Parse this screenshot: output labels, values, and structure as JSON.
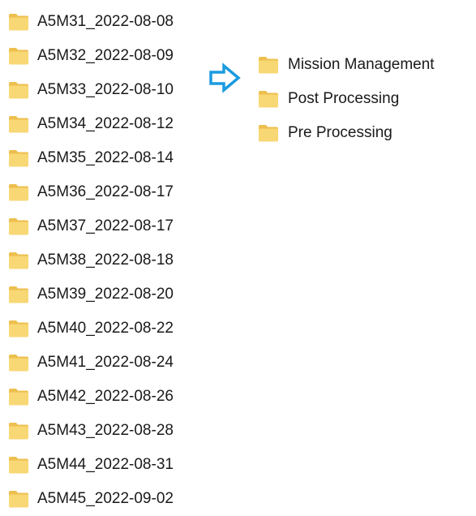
{
  "left_folders": [
    {
      "name": "A5M31_2022-08-08",
      "icon": "folder-icon"
    },
    {
      "name": "A5M32_2022-08-09",
      "icon": "folder-icon"
    },
    {
      "name": "A5M33_2022-08-10",
      "icon": "folder-icon"
    },
    {
      "name": "A5M34_2022-08-12",
      "icon": "folder-icon"
    },
    {
      "name": "A5M35_2022-08-14",
      "icon": "folder-icon"
    },
    {
      "name": "A5M36_2022-08-17",
      "icon": "folder-icon"
    },
    {
      "name": "A5M37_2022-08-17",
      "icon": "folder-icon"
    },
    {
      "name": "A5M38_2022-08-18",
      "icon": "folder-icon"
    },
    {
      "name": "A5M39_2022-08-20",
      "icon": "folder-icon"
    },
    {
      "name": "A5M40_2022-08-22",
      "icon": "folder-icon"
    },
    {
      "name": "A5M41_2022-08-24",
      "icon": "folder-icon"
    },
    {
      "name": "A5M42_2022-08-26",
      "icon": "folder-icon"
    },
    {
      "name": "A5M43_2022-08-28",
      "icon": "folder-icon"
    },
    {
      "name": "A5M44_2022-08-31",
      "icon": "folder-icon"
    },
    {
      "name": "A5M45_2022-09-02",
      "icon": "folder-icon"
    }
  ],
  "right_folders": [
    {
      "name": "Mission Management",
      "icon": "folder-icon"
    },
    {
      "name": "Post Processing",
      "icon": "folder-icon"
    },
    {
      "name": "Pre Processing",
      "icon": "folder-icon"
    }
  ],
  "arrow_icon": "right-arrow-icon",
  "colors": {
    "folder_light": "#F8D775",
    "folder_dark": "#EDBF4E",
    "arrow": "#1B9BE0",
    "text": "#1A1A1A"
  }
}
